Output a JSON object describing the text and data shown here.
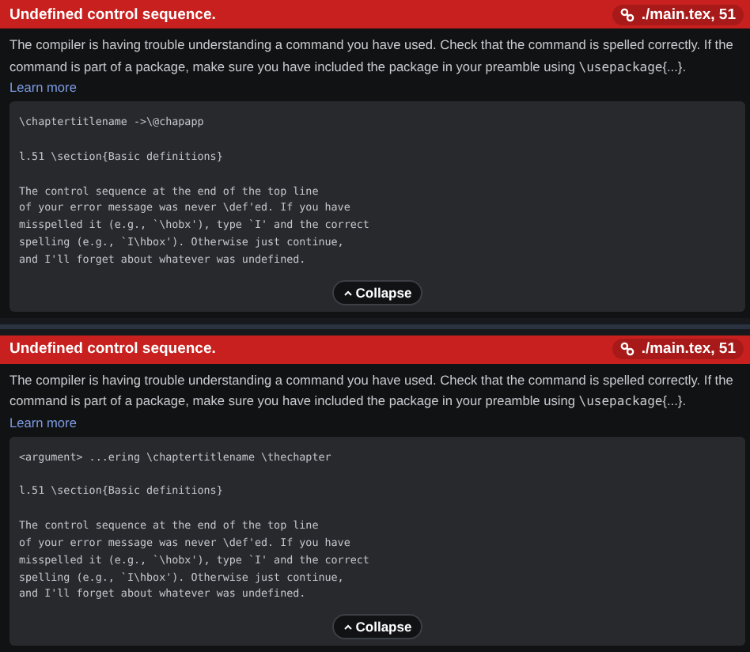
{
  "errors": [
    {
      "title": "Undefined control sequence.",
      "location": "./main.tex, 51",
      "description": [
        {
          "kind": "text",
          "text": "The compiler is having trouble understanding a command you have used. Check that the command is spelled correctly. If the command is part of a package, make sure you have included the package in your preamble using "
        },
        {
          "kind": "code",
          "text": "\\usepackage"
        },
        {
          "kind": "text",
          "text": "{...}."
        }
      ],
      "learn_more": "Learn more",
      "log": [
        [
          "\\chaptertitlename ->\\@chapapp"
        ],
        [
          "l.51 \\section{Basic definitions}"
        ],
        [
          "The control sequence at the end of the top line",
          "of your error message was never \\def'ed. If you have",
          "misspelled it (e.g., `\\hobx'), type `I' and the correct",
          "spelling (e.g., `I\\hbox'). Otherwise just continue,",
          "and I'll forget about whatever was undefined."
        ]
      ],
      "collapse": "Collapse",
      "expanded": true
    },
    {
      "title": "Undefined control sequence.",
      "location": "./main.tex, 51",
      "description": [
        {
          "kind": "text",
          "text": "The compiler is having trouble understanding a command you have used. Check that the command is spelled correctly. If the command is part of a package, make sure you have included the package in your preamble using "
        },
        {
          "kind": "code",
          "text": "\\usepackage"
        },
        {
          "kind": "text",
          "text": "{...}."
        }
      ],
      "learn_more": "Learn more",
      "log": [
        [
          "<argument> ...ering \\chaptertitlename \\thechapter"
        ],
        [
          "l.51 \\section{Basic definitions}"
        ],
        [
          "The control sequence at the end of the top line",
          "of your error message was never \\def'ed. If you have",
          "misspelled it (e.g., `\\hobx'), type `I' and the correct",
          "spelling (e.g., `I\\hbox'). Otherwise just continue,",
          "and I'll forget about whatever was undefined."
        ]
      ],
      "collapse": "Collapse",
      "expanded": true
    }
  ]
}
